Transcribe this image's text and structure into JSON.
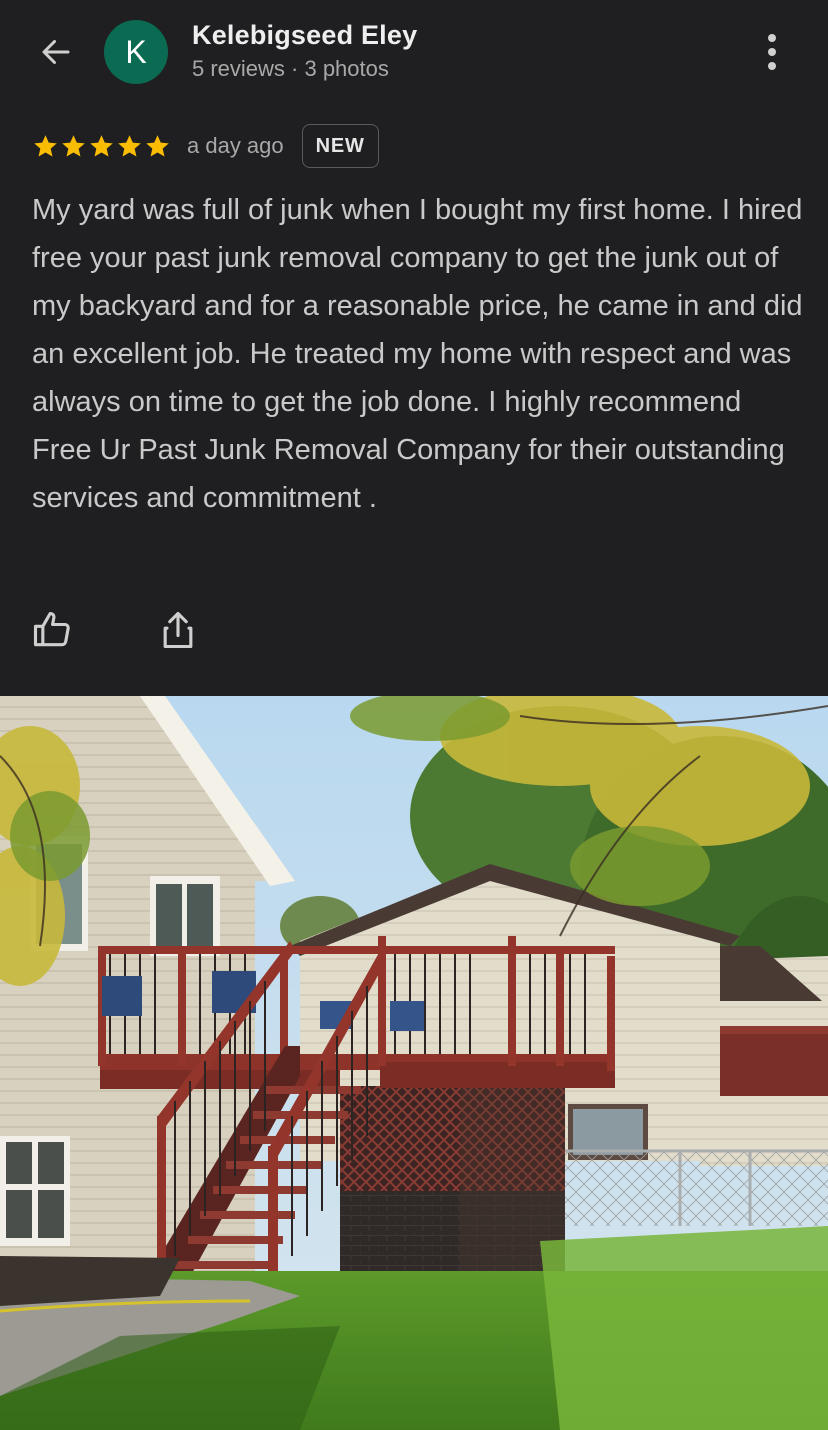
{
  "header": {
    "back_icon": "arrow-left-icon",
    "avatar_initial": "K",
    "avatar_color": "#0b6b52",
    "reviewer_name": "Kelebigseed Eley",
    "reviewer_meta": "5 reviews · 3 photos",
    "more_icon": "more-vertical-icon"
  },
  "review": {
    "rating": 5,
    "max_rating": 5,
    "star_color": "#fbbc04",
    "time_ago": "a day ago",
    "badge": "NEW",
    "text": "My yard was full of junk when I bought my first home. I hired free your past junk removal company to get the junk out of my backyard and for a reasonable price, he came in and did an excellent job. He treated my home with respect and was always on time to get the job done. I highly recommend Free Ur Past Junk Removal Company for their outstanding services and commitment ."
  },
  "actions": {
    "like_icon": "thumbs-up-icon",
    "share_icon": "share-icon"
  }
}
